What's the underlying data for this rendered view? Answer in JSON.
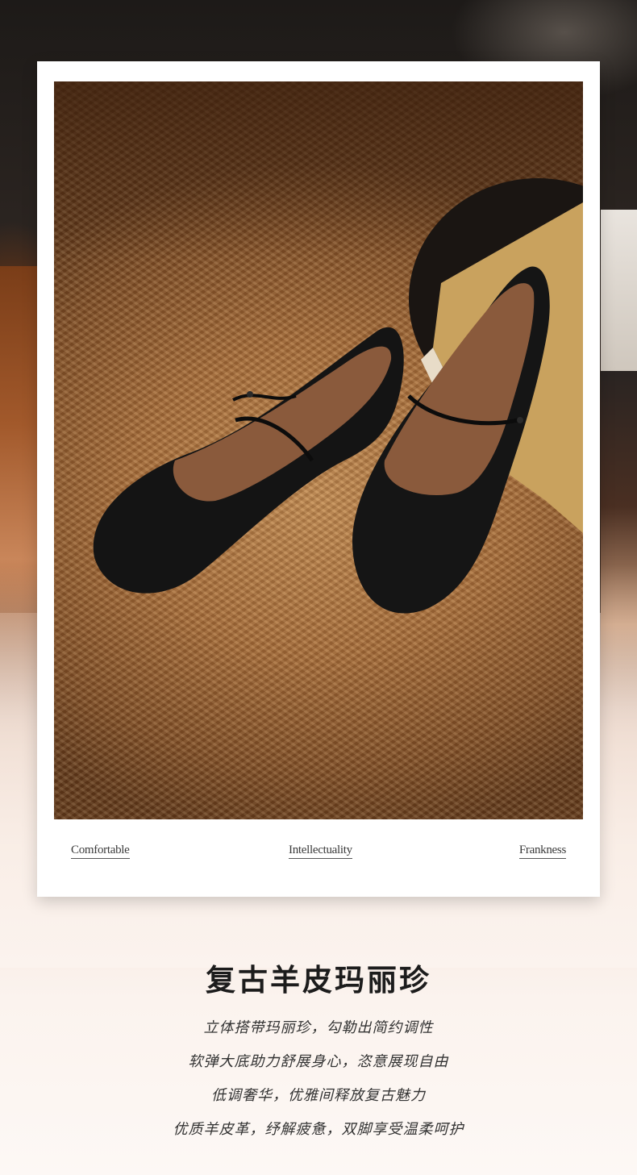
{
  "card": {
    "captions": [
      "Comfortable",
      "Intellectuality",
      "Frankness"
    ]
  },
  "headline": "复古羊皮玛丽珍",
  "description_lines": [
    "立体搭带玛丽珍，勾勒出简约调性",
    "软弹大底助力舒展身心，恣意展现自由",
    "低调奢华，优雅间释放复古魅力",
    "优质羊皮革，纾解疲惫，双脚享受温柔呵护"
  ],
  "colors": {
    "shoe": "#141414",
    "insole": "#8a5a3c",
    "rug": "#b07a45",
    "text": "#1c1c1c"
  }
}
